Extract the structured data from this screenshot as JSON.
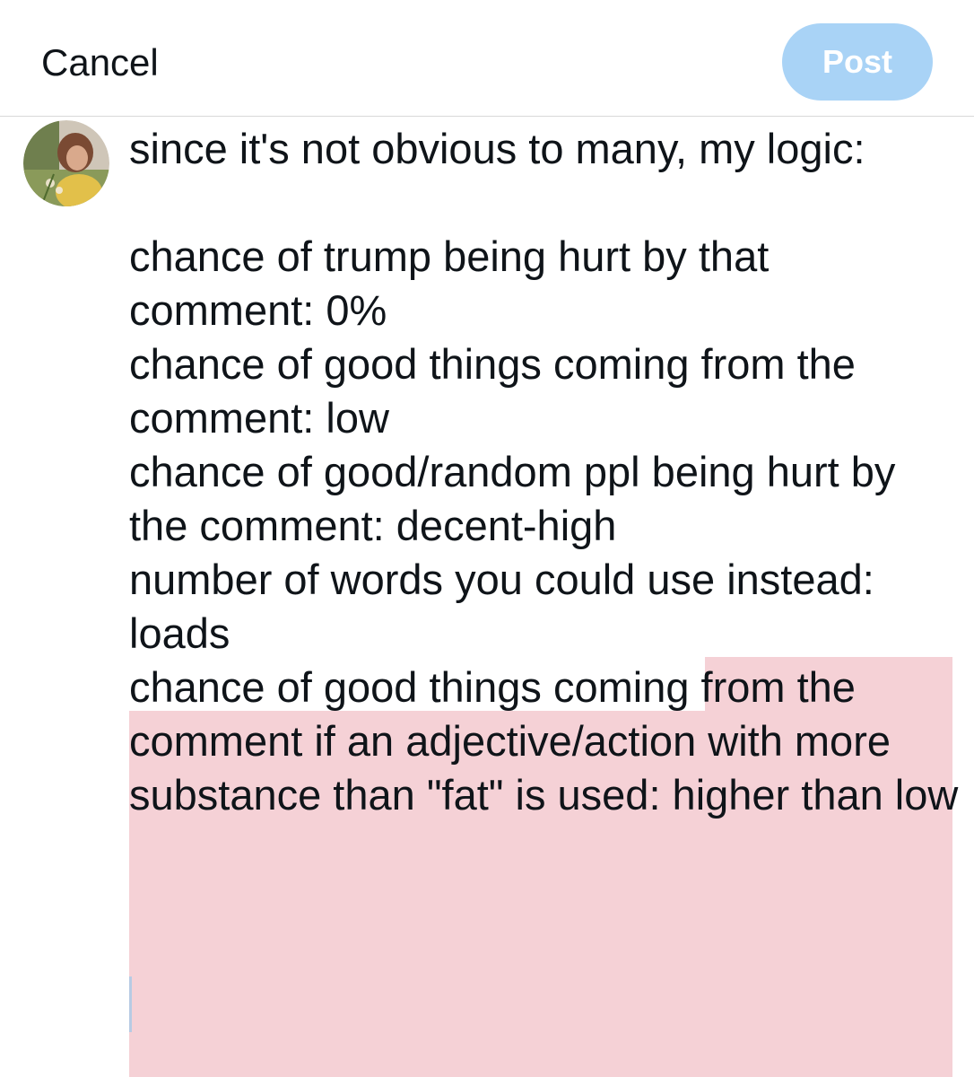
{
  "header": {
    "cancel_label": "Cancel",
    "post_label": "Post",
    "post_bg": "#a9d3f6"
  },
  "composer": {
    "avatar_icon": "user-avatar-photo",
    "text": "since it's not obvious to many, my logic:\n\nchance of trump being hurt by that comment: 0%\nchance of good things coming from the comment: low\nchance of good/random ppl being hurt by the comment: decent-high\nnumber of words you could use instead: loads\nchance of good things coming from the comment if an adjective/action with more substance than \"fat\" is used: higher than low",
    "highlight_color": "#f5d1d6"
  }
}
